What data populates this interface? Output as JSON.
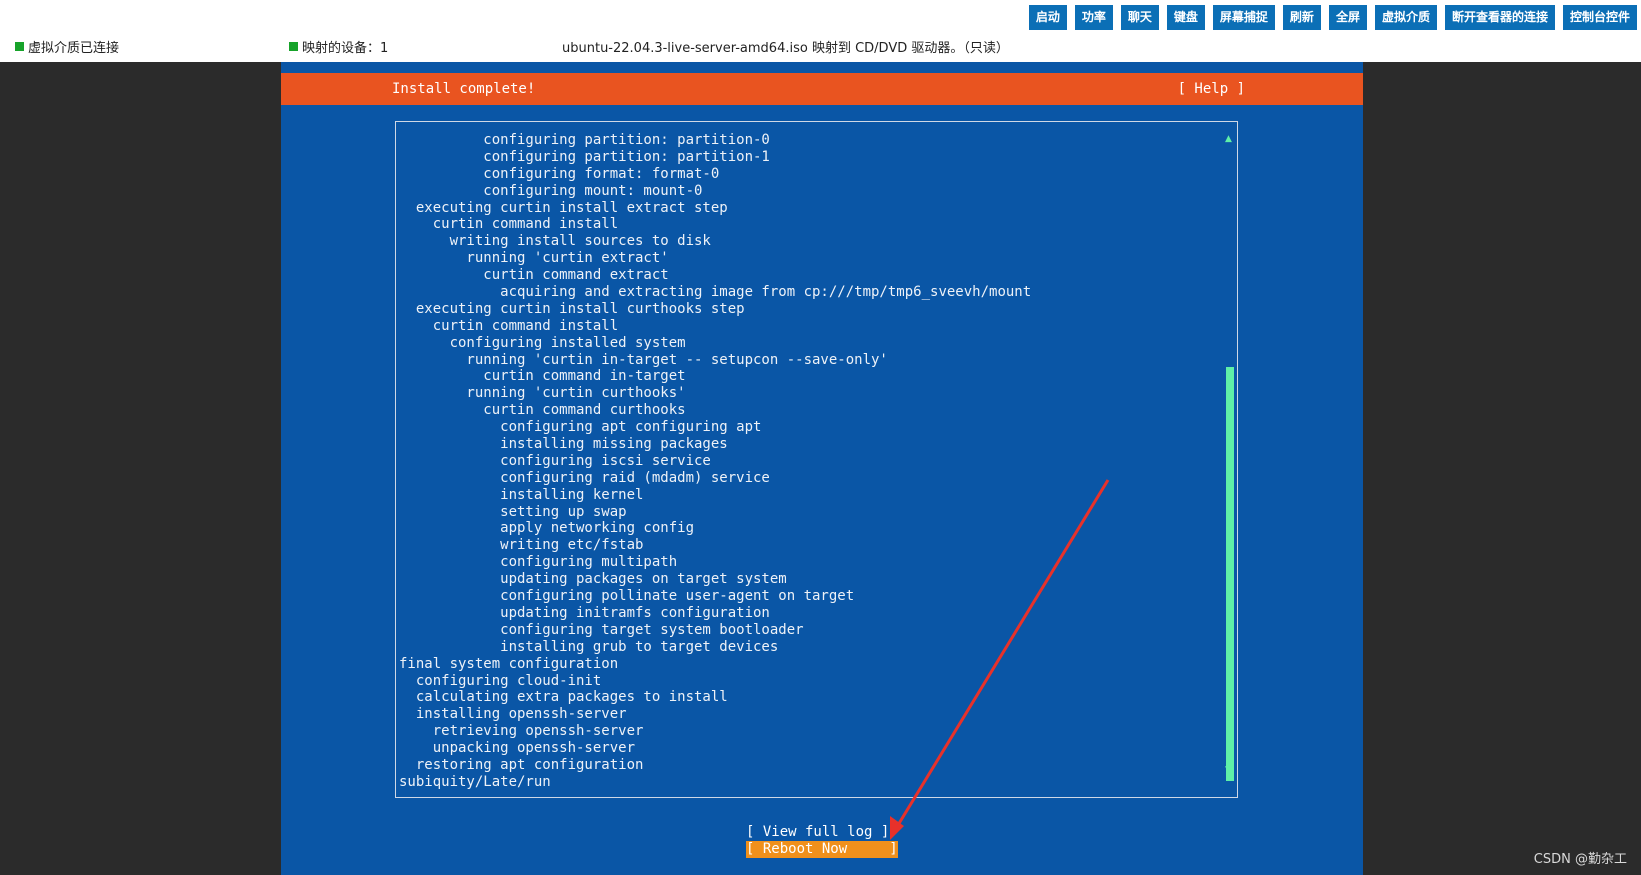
{
  "toolbar": {
    "buttons": [
      "启动",
      "功率",
      "聊天",
      "键盘",
      "屏幕捕捉",
      "刷新",
      "全屏",
      "虚拟介质",
      "断开查看器的连接",
      "控制台控件"
    ]
  },
  "status": {
    "media_connected": "虚拟介质已连接",
    "mapped_devices": "映射的设备：1",
    "mapped_iso": "ubuntu-22.04.3-live-server-amd64.iso 映射到 CD/DVD 驱动器。（只读）"
  },
  "console": {
    "header_title": "Install complete!",
    "help_label": "[ Help ]",
    "log_lines": [
      "          configuring partition: partition-0",
      "          configuring partition: partition-1",
      "          configuring format: format-0",
      "          configuring mount: mount-0",
      "  executing curtin install extract step",
      "    curtin command install",
      "      writing install sources to disk",
      "        running 'curtin extract'",
      "          curtin command extract",
      "            acquiring and extracting image from cp:///tmp/tmp6_sveevh/mount",
      "  executing curtin install curthooks step",
      "    curtin command install",
      "      configuring installed system",
      "        running 'curtin in-target -- setupcon --save-only'",
      "          curtin command in-target",
      "        running 'curtin curthooks'",
      "          curtin command curthooks",
      "            configuring apt configuring apt",
      "            installing missing packages",
      "            configuring iscsi service",
      "            configuring raid (mdadm) service",
      "            installing kernel",
      "            setting up swap",
      "            apply networking config",
      "            writing etc/fstab",
      "            configuring multipath",
      "            updating packages on target system",
      "            configuring pollinate user-agent on target",
      "            updating initramfs configuration",
      "            configuring target system bootloader",
      "            installing grub to target devices",
      "final system configuration",
      "  configuring cloud-init",
      "  calculating extra packages to install",
      "  installing openssh-server",
      "    retrieving openssh-server",
      "    unpacking openssh-server",
      "  restoring apt configuration",
      "subiquity/Late/run"
    ],
    "view_log_label": "[ View full log ]",
    "reboot_label": "[ Reboot Now     ]",
    "scroll_up_icon": "triangle-up",
    "scroll_down_icon": "triangle-down"
  },
  "watermark": "CSDN @勤杂工",
  "colors": {
    "console_bg": "#0a56a6",
    "header_bg": "#e95420",
    "scroll_thumb": "#5ff0a8",
    "reboot_highlight": "#f0901b",
    "arrow": "#e8312a"
  }
}
